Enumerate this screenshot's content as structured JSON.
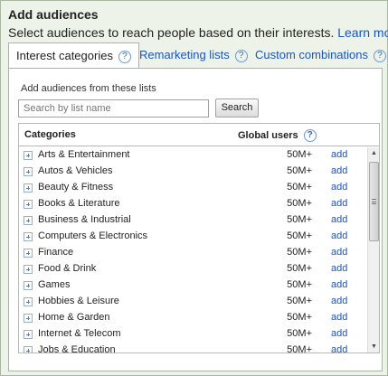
{
  "header": {
    "title": "Add audiences",
    "subtitle": "Select audiences to reach people based on their interests.",
    "learn_more": "Learn more"
  },
  "tabs": [
    {
      "label": "Interest categories",
      "active": true
    },
    {
      "label": "Remarketing lists",
      "active": false
    },
    {
      "label": "Custom combinations",
      "active": false
    }
  ],
  "help_icon": "?",
  "panel": {
    "lists_label": "Add audiences from these lists",
    "search_placeholder": "Search by list name",
    "search_button": "Search"
  },
  "table": {
    "col_categories": "Categories",
    "col_global_users": "Global users",
    "rows": [
      {
        "name": "Arts & Entertainment",
        "users": "50M+",
        "action": "add"
      },
      {
        "name": "Autos & Vehicles",
        "users": "50M+",
        "action": "add"
      },
      {
        "name": "Beauty & Fitness",
        "users": "50M+",
        "action": "add"
      },
      {
        "name": "Books & Literature",
        "users": "50M+",
        "action": "add"
      },
      {
        "name": "Business & Industrial",
        "users": "50M+",
        "action": "add"
      },
      {
        "name": "Computers & Electronics",
        "users": "50M+",
        "action": "add"
      },
      {
        "name": "Finance",
        "users": "50M+",
        "action": "add"
      },
      {
        "name": "Food & Drink",
        "users": "50M+",
        "action": "add"
      },
      {
        "name": "Games",
        "users": "50M+",
        "action": "add"
      },
      {
        "name": "Hobbies & Leisure",
        "users": "50M+",
        "action": "add"
      },
      {
        "name": "Home & Garden",
        "users": "50M+",
        "action": "add"
      },
      {
        "name": "Internet & Telecom",
        "users": "50M+",
        "action": "add"
      },
      {
        "name": "Jobs & Education",
        "users": "50M+",
        "action": "add"
      }
    ]
  },
  "icons": {
    "help": "question-circle-icon",
    "expand": "plus-square-icon",
    "scroll_up": "triangle-up-icon",
    "scroll_down": "triangle-down-icon"
  },
  "colors": {
    "link": "#1a55c0",
    "panel_bg": "#eef3ea",
    "border": "#a9b7a0"
  }
}
